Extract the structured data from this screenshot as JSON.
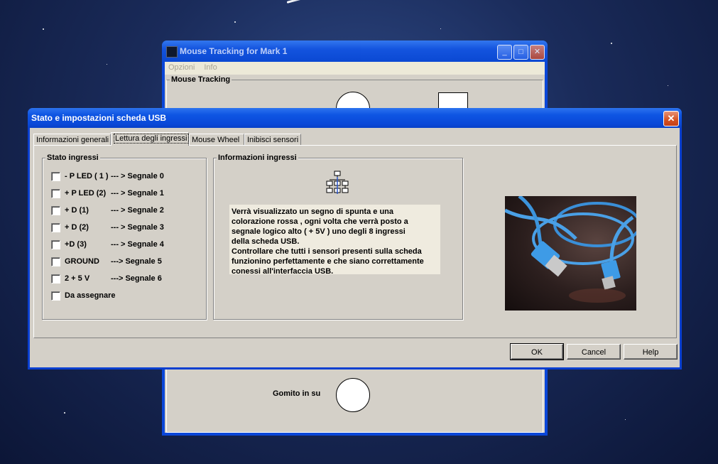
{
  "background_window": {
    "title": "Mouse Tracking for Mark 1",
    "menu": [
      "Opzioni",
      "Info"
    ],
    "group_title": "Mouse Tracking",
    "elbow_label": "Gomito in su"
  },
  "dialog": {
    "title": "Stato e impostazioni scheda USB",
    "tabs": [
      {
        "label": "Informazioni generali",
        "active": false
      },
      {
        "label": "Lettura degli ingressi",
        "active": true
      },
      {
        "label": "Mouse Wheel",
        "active": false
      },
      {
        "label": "Inibisci sensori",
        "active": false
      }
    ],
    "inputs_group": {
      "title": "Stato ingressi",
      "items": [
        {
          "label": "- P LED ( 1 )",
          "signal": "--- > Segnale 0",
          "checked": false
        },
        {
          "label": "+ P LED (2)",
          "signal": "--- > Segnale 1",
          "checked": false
        },
        {
          "label": "+ D (1)",
          "signal": "--- > Segnale 2",
          "checked": false
        },
        {
          "label": "+ D (2)",
          "signal": "--- > Segnale 3",
          "checked": false
        },
        {
          "label": "+D (3)",
          "signal": "--- > Segnale 4",
          "checked": false
        },
        {
          "label": "GROUND",
          "signal": "---> Segnale 5",
          "checked": false
        },
        {
          "label": "2 + 5 V",
          "signal": "---> Segnale 6",
          "checked": false
        },
        {
          "label": "Da assegnare",
          "signal": "",
          "checked": false
        }
      ]
    },
    "info_group": {
      "title": "Informazioni ingressi",
      "icon": "network-icon",
      "text": "Verrà visualizzato un segno di spunta e una\ncolorazione rossa , ogni volta che verrà posto a\nsegnale logico alto ( + 5V ) uno degli 8 ingressi\ndella scheda USB.\nControllare che tutti i sensori presenti sulla scheda\nfunzionino perfettamente e che siano correttamente\nconessi all'interfaccia USB."
    },
    "buttons": {
      "ok": "OK",
      "cancel": "Cancel",
      "help": "Help"
    }
  },
  "colors": {
    "titlebar": "#0a48d8",
    "dialog_face": "#d4d0c8",
    "info_background": "#efebdf",
    "close_button": "#d5501f"
  }
}
